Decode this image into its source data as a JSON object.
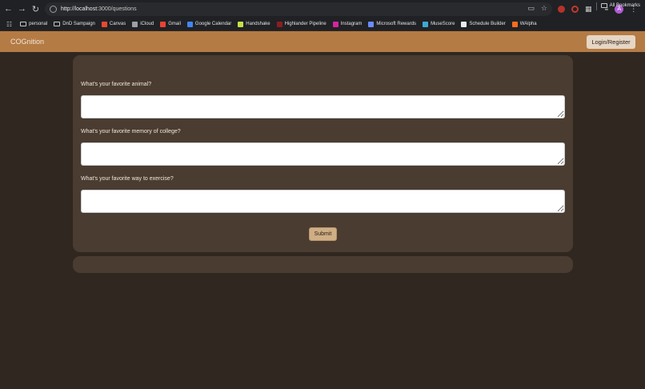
{
  "browser": {
    "url_host": "http://localhost",
    "url_path": ":3000/questions",
    "bookmarks": [
      {
        "label": "personal",
        "type": "folder"
      },
      {
        "label": "DnD Sampaign",
        "type": "folder"
      },
      {
        "label": "Canvas",
        "color": "#e64a32"
      },
      {
        "label": "iCloud",
        "color": "#9aa0a6"
      },
      {
        "label": "Gmail",
        "color": "#ea4335"
      },
      {
        "label": "Google Calendar",
        "color": "#4285f4"
      },
      {
        "label": "Handshake",
        "color": "#c6e04a"
      },
      {
        "label": "Highlander Pipeline",
        "color": "#8b1e1e"
      },
      {
        "label": "Instagram",
        "color": "#d6249f"
      },
      {
        "label": "Microsoft Rewards",
        "color": "#6b8cff"
      },
      {
        "label": "MuseScore",
        "color": "#3ea7d6"
      },
      {
        "label": "Schedule Builder",
        "color": "#e8eaed"
      },
      {
        "label": "WAlpha",
        "color": "#f26d21"
      }
    ],
    "all_bookmarks_label": "All Bookmarks",
    "avatar_letter": "A"
  },
  "app": {
    "brand": "COGnition",
    "login_label": "Login/Register",
    "header_color": "#b47b45"
  },
  "questions": [
    {
      "label": "What's your favorite animal?",
      "value": ""
    },
    {
      "label": "What's your favorite memory of college?",
      "value": ""
    },
    {
      "label": "What's your favorite way to exercise?",
      "value": ""
    }
  ],
  "submit_label": "Submit"
}
